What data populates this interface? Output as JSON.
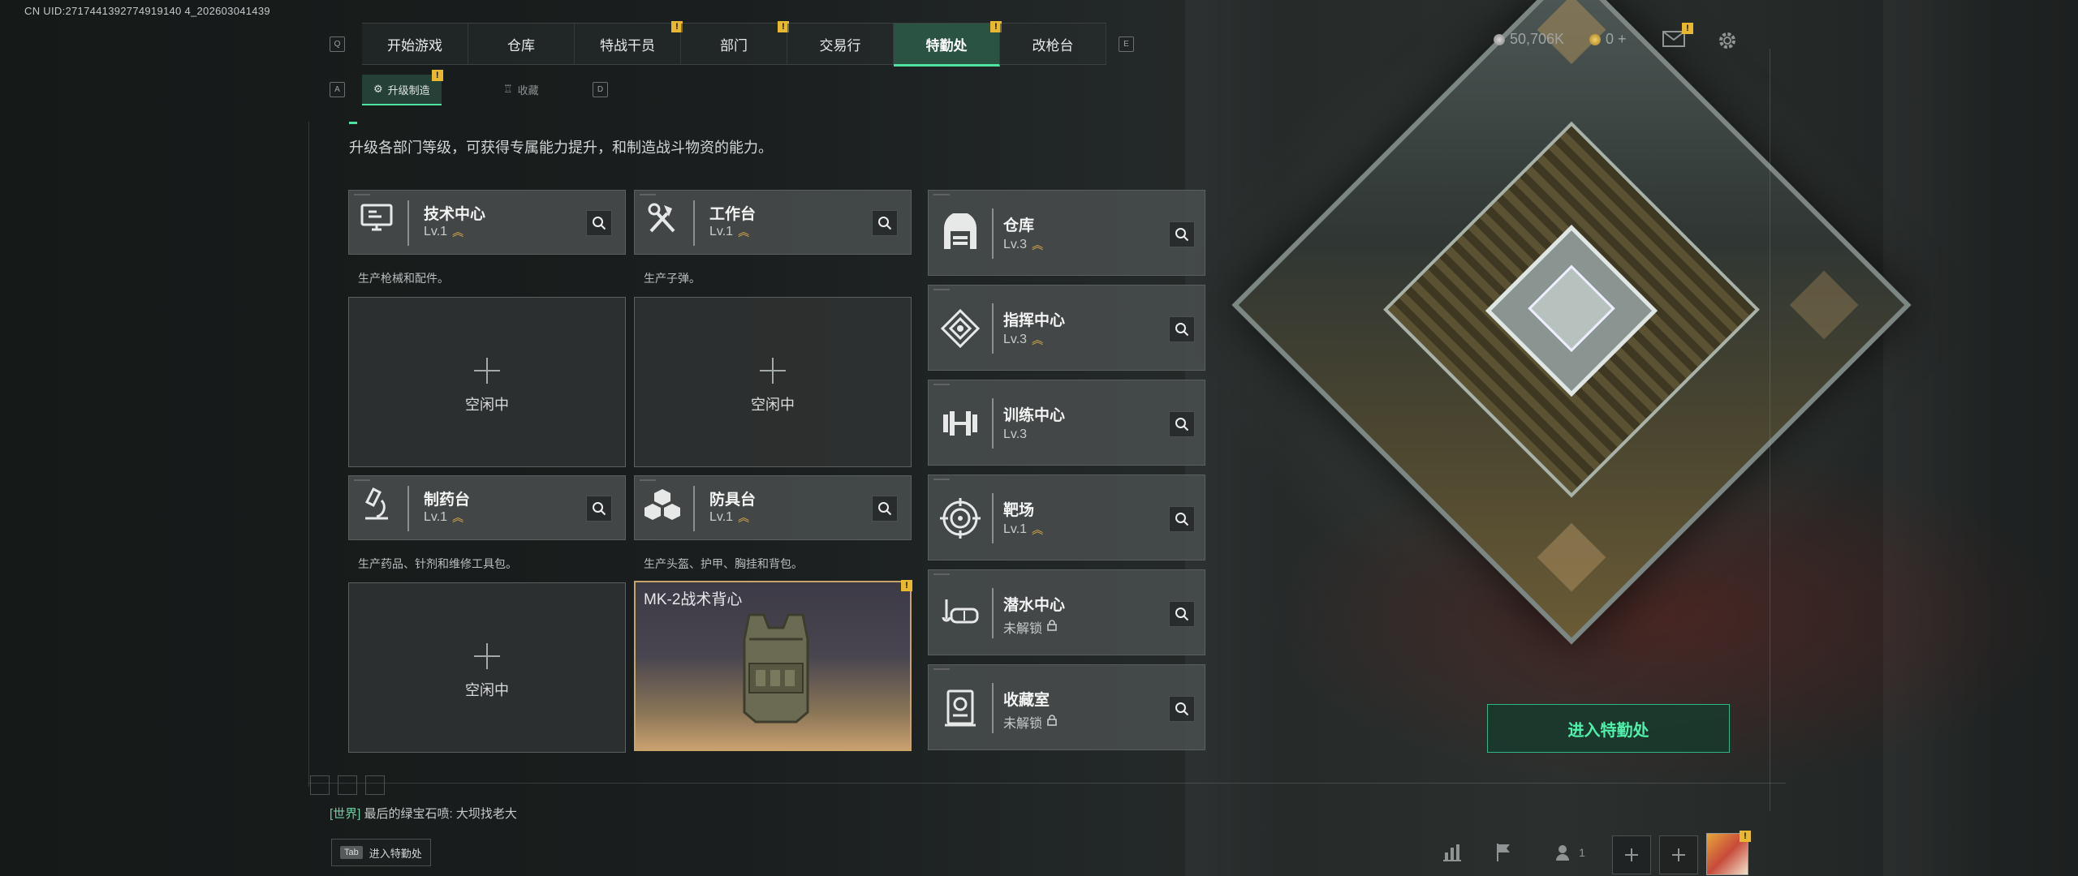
{
  "uid": "CN UID:2717441392774919140 4_202603041439",
  "nav": {
    "key_left": "Q",
    "key_right": "E",
    "tabs": [
      {
        "label": "开始游戏",
        "badge": ""
      },
      {
        "label": "仓库",
        "badge": ""
      },
      {
        "label": "特战干员",
        "badge": "!"
      },
      {
        "label": "部门",
        "badge": "!"
      },
      {
        "label": "交易行",
        "badge": ""
      },
      {
        "label": "特勤处",
        "badge": "!",
        "active": true
      },
      {
        "label": "改枪台",
        "badge": ""
      }
    ]
  },
  "currency": {
    "coins": "50,706K",
    "tickets": "0 +"
  },
  "mail_badge": "!",
  "subnav": {
    "key_left": "A",
    "key_right": "D",
    "tabs": [
      {
        "label": "升级制造",
        "badge": "!",
        "active": true
      },
      {
        "label": "收藏",
        "badge": ""
      }
    ]
  },
  "description": "升级各部门等级，可获得专属能力提升，和制造战斗物资的能力。",
  "workshops": [
    {
      "name": "技术中心",
      "level": "Lv.1",
      "sub": "生产枪械和配件。",
      "slot": "空闲中",
      "icon": "monitor-icon"
    },
    {
      "name": "工作台",
      "level": "Lv.1",
      "sub": "生产子弹。",
      "slot": "空闲中",
      "icon": "tools-icon"
    },
    {
      "name": "制药台",
      "level": "Lv.1",
      "sub": "生产药品、针剂和维修工具包。",
      "slot": "空闲中",
      "icon": "microscope-icon"
    },
    {
      "name": "防具台",
      "level": "Lv.1",
      "sub": "生产头盔、护甲、胸挂和背包。",
      "craft_item": "MK-2战术背心",
      "craft_badge": "!",
      "icon": "boxes-icon"
    }
  ],
  "facilities": [
    {
      "name": "仓库",
      "level": "Lv.3",
      "upgradable": true,
      "icon": "warehouse-icon"
    },
    {
      "name": "指挥中心",
      "level": "Lv.3",
      "upgradable": true,
      "icon": "command-icon"
    },
    {
      "name": "训练中心",
      "level": "Lv.3",
      "upgradable": false,
      "icon": "dumbbell-icon"
    },
    {
      "name": "靶场",
      "level": "Lv.1",
      "upgradable": true,
      "icon": "target-icon"
    },
    {
      "name": "潜水中心",
      "level": "未解锁",
      "locked": true,
      "icon": "diving-mask-icon"
    },
    {
      "name": "收藏室",
      "level": "未解锁",
      "locked": true,
      "icon": "collection-icon"
    }
  ],
  "enter_button": "进入特勤处",
  "chat": {
    "channel": "[世界]",
    "sender": "最后的绿宝石喷:",
    "message": "大坝找老大"
  },
  "tab_hint": {
    "key": "Tab",
    "label": "进入特勤处"
  },
  "friends_count": "1",
  "avatar_badge": "!",
  "colors": {
    "accent": "#4fe3a2",
    "badge": "#e8b830",
    "upgrade_chevron": "#e3b34a"
  }
}
